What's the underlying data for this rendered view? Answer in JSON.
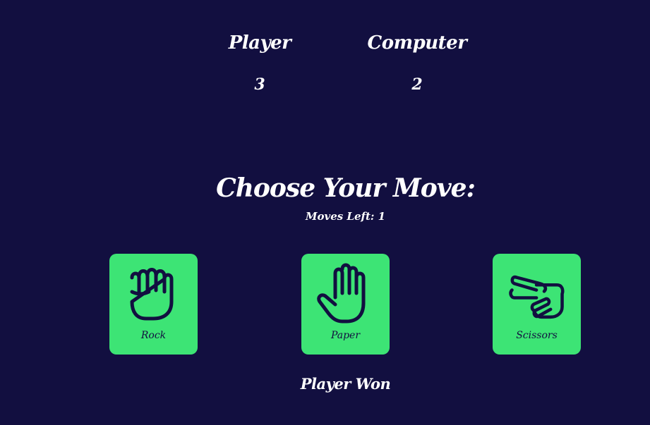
{
  "scoreboard": {
    "player_label": "Player",
    "player_score": "3",
    "computer_label": "Computer",
    "computer_score": "2"
  },
  "prompt": {
    "heading": "Choose Your Move:",
    "moves_left": "Moves Left: 1"
  },
  "moves": [
    {
      "label": "Rock",
      "icon": "fist-icon"
    },
    {
      "label": "Paper",
      "icon": "open-hand-icon"
    },
    {
      "label": "Scissors",
      "icon": "victory-hand-icon"
    }
  ],
  "result": "Player Won",
  "colors": {
    "background": "#120f40",
    "card": "#3de475",
    "text": "#ffffff",
    "icon": "#120f40"
  }
}
